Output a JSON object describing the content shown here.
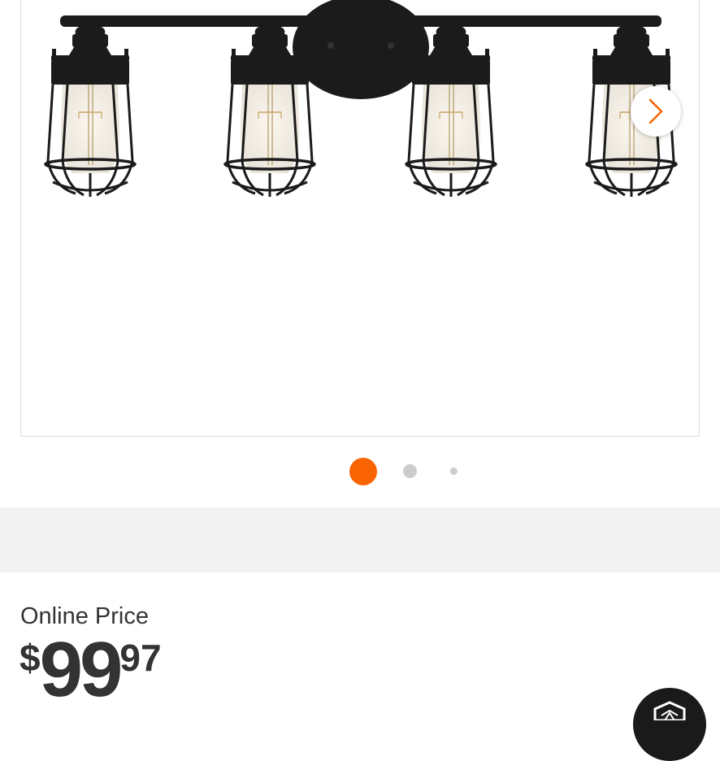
{
  "gallery": {
    "next_label": "Next image",
    "active_dot_color": "#f96302",
    "inactive_dot_color": "#cccccc",
    "dot_count": 3,
    "active_index": 1
  },
  "pricing": {
    "label": "Online Price",
    "currency": "$",
    "dollars": "99",
    "cents": "97"
  },
  "icons": {
    "next": "chevron-right-icon",
    "chat": "chat-assistant-icon"
  },
  "colors": {
    "brand_orange": "#f96302",
    "price_text": "#333333",
    "band_gray": "#f2f2f2"
  }
}
